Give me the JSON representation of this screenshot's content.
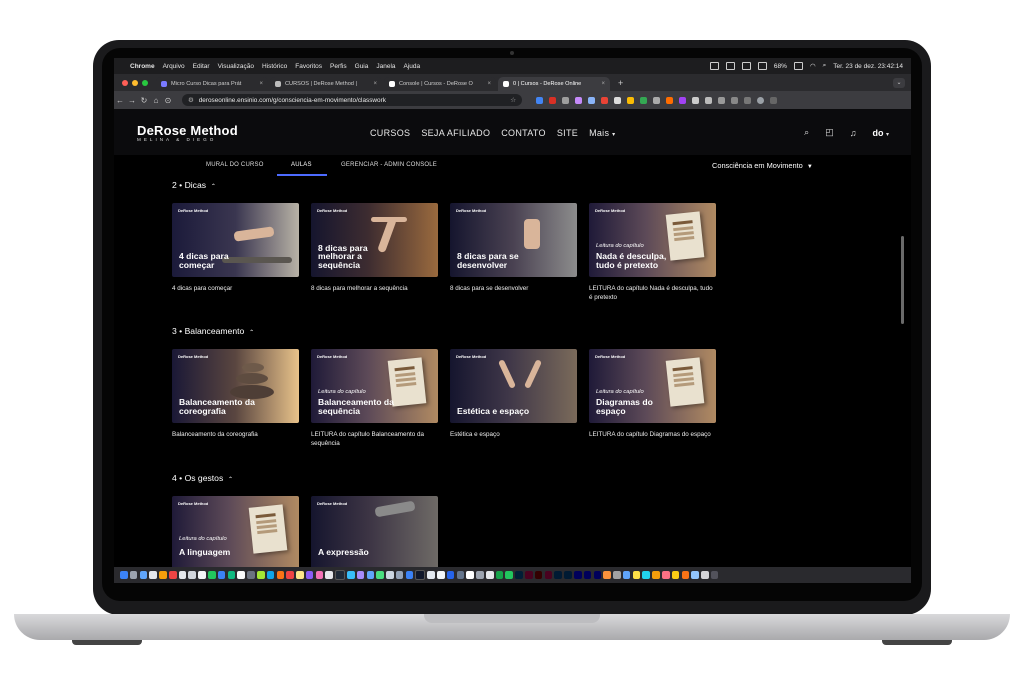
{
  "menubar": {
    "app": "Chrome",
    "items": [
      "Arquivo",
      "Editar",
      "Visualização",
      "Histórico",
      "Favoritos",
      "Perfis",
      "Guia",
      "Janela",
      "Ajuda"
    ],
    "battery": "68%",
    "clock": "Ter. 23 de dez.  23:42:14"
  },
  "tabs": [
    {
      "title": "Micro Curso Dicas para Prát"
    },
    {
      "title": "CURSOS | DeRose Method |"
    },
    {
      "title": "Console | Cursos - DeRose O"
    },
    {
      "title": "0 | Cursos - DeRose Online"
    }
  ],
  "toolbar": {
    "url": "deroseonline.ensinio.com/g/consciencia-em-movimento/classwork"
  },
  "header": {
    "logo_main": "DeRose Method",
    "logo_sub": "MELINA & DIEGO",
    "nav": [
      "CURSOS",
      "SEJA AFILIADO",
      "CONTATO",
      "SITE",
      "Mais"
    ],
    "user_logo": "do"
  },
  "subnav": {
    "tabs": [
      "MURAL DO CURSO",
      "AULAS",
      "GERENCIAR - ADMIN CONSOLE"
    ],
    "course": "Consciência em Movimento"
  },
  "sections": [
    {
      "title": "2 • Dicas",
      "cards": [
        {
          "brand": "DeRose Method",
          "kicker": "",
          "thumb_title": "4 dicas para começar",
          "label": "4 dicas para começar"
        },
        {
          "brand": "DeRose Method",
          "kicker": "",
          "thumb_title": "8 dicas para melhorar a sequência",
          "label": "8 dicas para melhorar a sequência"
        },
        {
          "brand": "DeRose Method",
          "kicker": "",
          "thumb_title": "8 dicas para se desenvolver",
          "label": "8 dicas para se desenvolver"
        },
        {
          "brand": "DeRose Method",
          "kicker": "Leitura do capítulo",
          "thumb_title": "Nada é desculpa, tudo é pretexto",
          "label": "LEITURA do capítulo Nada é desculpa, tudo é pretexto"
        }
      ]
    },
    {
      "title": "3 • Balanceamento",
      "cards": [
        {
          "brand": "DeRose Method",
          "kicker": "",
          "thumb_title": "Balanceamento da coreografia",
          "label": "Balanceamento da coreografia"
        },
        {
          "brand": "DeRose Method",
          "kicker": "Leitura do capítulo",
          "thumb_title": "Balanceamento da sequência",
          "label": "LEITURA do capítulo Balanceamento da sequência"
        },
        {
          "brand": "DeRose Method",
          "kicker": "",
          "thumb_title": "Estética e espaço",
          "label": "Estética e espaço"
        },
        {
          "brand": "DeRose Method",
          "kicker": "Leitura do capítulo",
          "thumb_title": "Diagramas do espaço",
          "label": "LEITURA do capítulo Diagramas do espaço"
        }
      ]
    },
    {
      "title": "4 • Os gestos",
      "cards": [
        {
          "brand": "DeRose Method",
          "kicker": "Leitura do capítulo",
          "thumb_title": "A linguagem",
          "label": ""
        },
        {
          "brand": "DeRose Method",
          "kicker": "",
          "thumb_title": "A expressão",
          "label": ""
        }
      ]
    }
  ],
  "colors": {
    "background": "#000000",
    "accent_underline": "#4d6bff",
    "book_thumb": "#a9805a",
    "photo_thumb": "#3b3550"
  }
}
